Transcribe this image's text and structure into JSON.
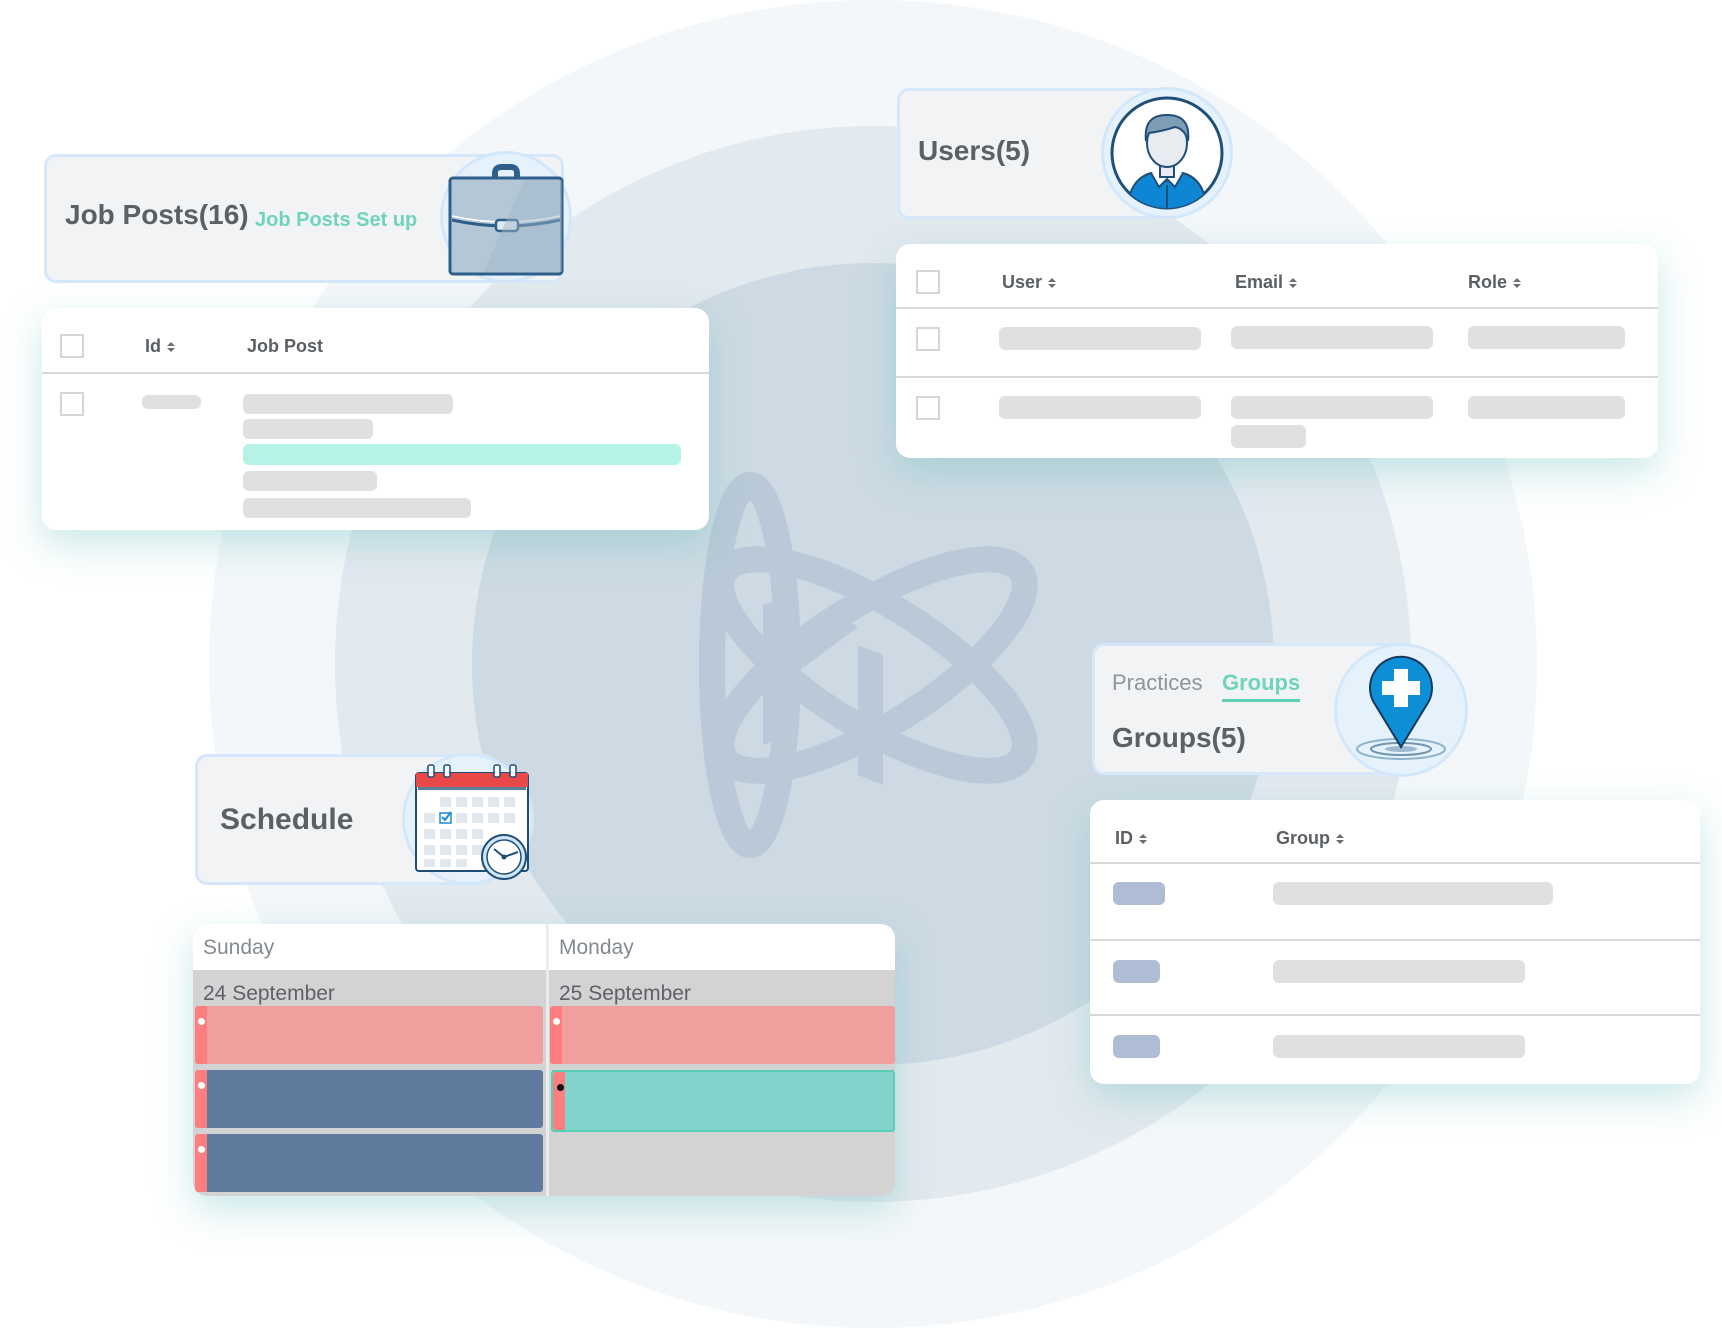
{
  "colors": {
    "accent_teal": "#5fcfb5",
    "header_border": "#d5e8fb",
    "placeholder_gray": "#e0e0e0",
    "placeholder_teal": "#b5f3e6",
    "placeholder_blue": "#aebdd3",
    "event_pink": "#f19e9e",
    "event_navy": "#5f7c9f",
    "event_teal": "#82d3cb",
    "event_strip": "#fd7e7e"
  },
  "background": {
    "logo_icon": "atom-k-logo-icon"
  },
  "job_posts": {
    "title": "Job Posts(16)",
    "setup_link": "Job Posts Set up",
    "icon": "briefcase-icon",
    "table": {
      "columns": [
        {
          "label": "Id",
          "sortable": true
        },
        {
          "label": "Job Post",
          "sortable": false
        }
      ],
      "rows": 1
    }
  },
  "users": {
    "title": "Users(5)",
    "icon": "user-avatar-icon",
    "table": {
      "columns": [
        {
          "label": "User",
          "sortable": true
        },
        {
          "label": "Email",
          "sortable": true
        },
        {
          "label": "Role",
          "sortable": true
        }
      ],
      "rows": 2
    }
  },
  "groups": {
    "tabs": [
      {
        "label": "Practices",
        "active": false
      },
      {
        "label": "Groups",
        "active": true
      }
    ],
    "title": "Groups(5)",
    "icon": "map-pin-plus-icon",
    "table": {
      "columns": [
        {
          "label": "ID",
          "sortable": true
        },
        {
          "label": "Group",
          "sortable": true
        }
      ],
      "rows": 3
    }
  },
  "schedule": {
    "title": "Schedule",
    "icon": "calendar-clock-icon",
    "days": [
      {
        "name": "Sunday",
        "date": "24 September",
        "events": [
          "pink",
          "navy",
          "navy"
        ]
      },
      {
        "name": "Monday",
        "date": "25 September",
        "events": [
          "pink",
          "teal"
        ]
      }
    ]
  }
}
